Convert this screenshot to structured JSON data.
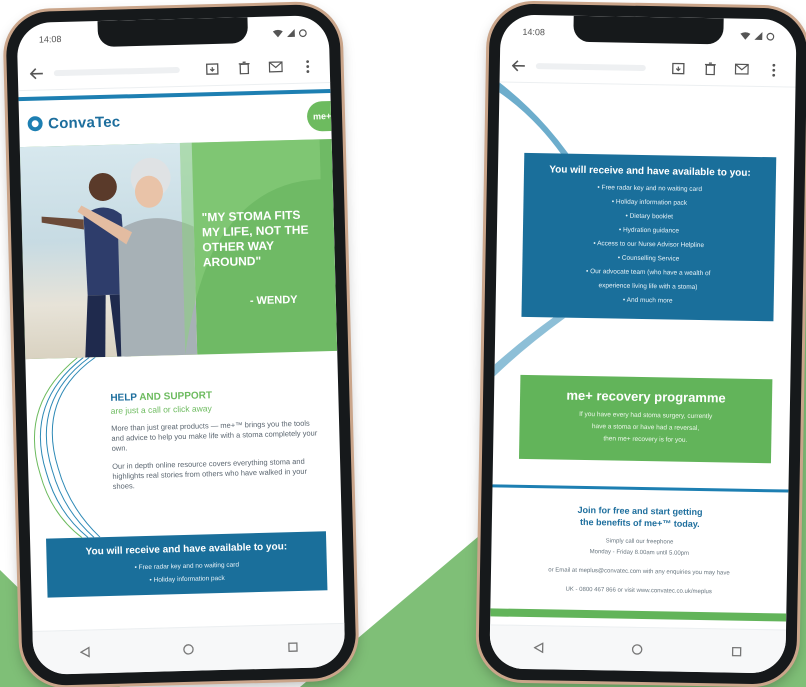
{
  "colors": {
    "brand_blue": "#1a6f9b",
    "brand_green": "#62b45a",
    "background_green": "#7fbf77"
  },
  "status": {
    "time_left": "14:08",
    "time_right": "14:08"
  },
  "left_email": {
    "brand": "ConvaTec",
    "badge": "me+",
    "quote": "\"MY STOMA FITS MY LIFE, NOT THE OTHER WAY AROUND\"",
    "author": "- WENDY",
    "help_title_part1": "HELP",
    "help_title_mid": " AND ",
    "help_title_part2": "SUPPORT",
    "help_subtitle": "are just a call or click away",
    "paragraph1": "More than just great products — me+™ brings you the tools and advice to help you make life with a stoma completely your own.",
    "paragraph2": "Our in depth online resource covers everything stoma and highlights real stories from others who have walked in your shoes.",
    "box_title": "You will receive and have available to you:",
    "box_items": [
      "• Free radar key and no waiting card",
      "• Holiday information pack"
    ]
  },
  "right_email": {
    "box_title": "You will receive and have available to you:",
    "box_items": [
      "• Free radar key and no waiting card",
      "• Holiday information pack",
      "• Dietary booklet",
      "• Hydration guidance",
      "• Access to our Nurse Advisor Helpline",
      "• Counselling Service",
      "• Our advocate team (who have a wealth of",
      "experience living life with a stoma)",
      "• And much more"
    ],
    "recovery_title": "me+ recovery programme",
    "recovery_line1": "If you have every had stoma surgery, currently",
    "recovery_line2": "have a stoma or have had a reversal,",
    "recovery_line3": "then me+ recovery is for you.",
    "join_line1": "Join for free and start getting",
    "join_line2": "the benefits of me+™ today.",
    "call_line1": "Simply call our freephone",
    "call_line2": "Monday - Friday 8.00am until 5.00pm",
    "email_line": "or Email at meplus@convatec.com with any enquiries you may have",
    "uk_line": "UK - 0800 467 866 or visit www.convatec.co.uk/meplus"
  }
}
